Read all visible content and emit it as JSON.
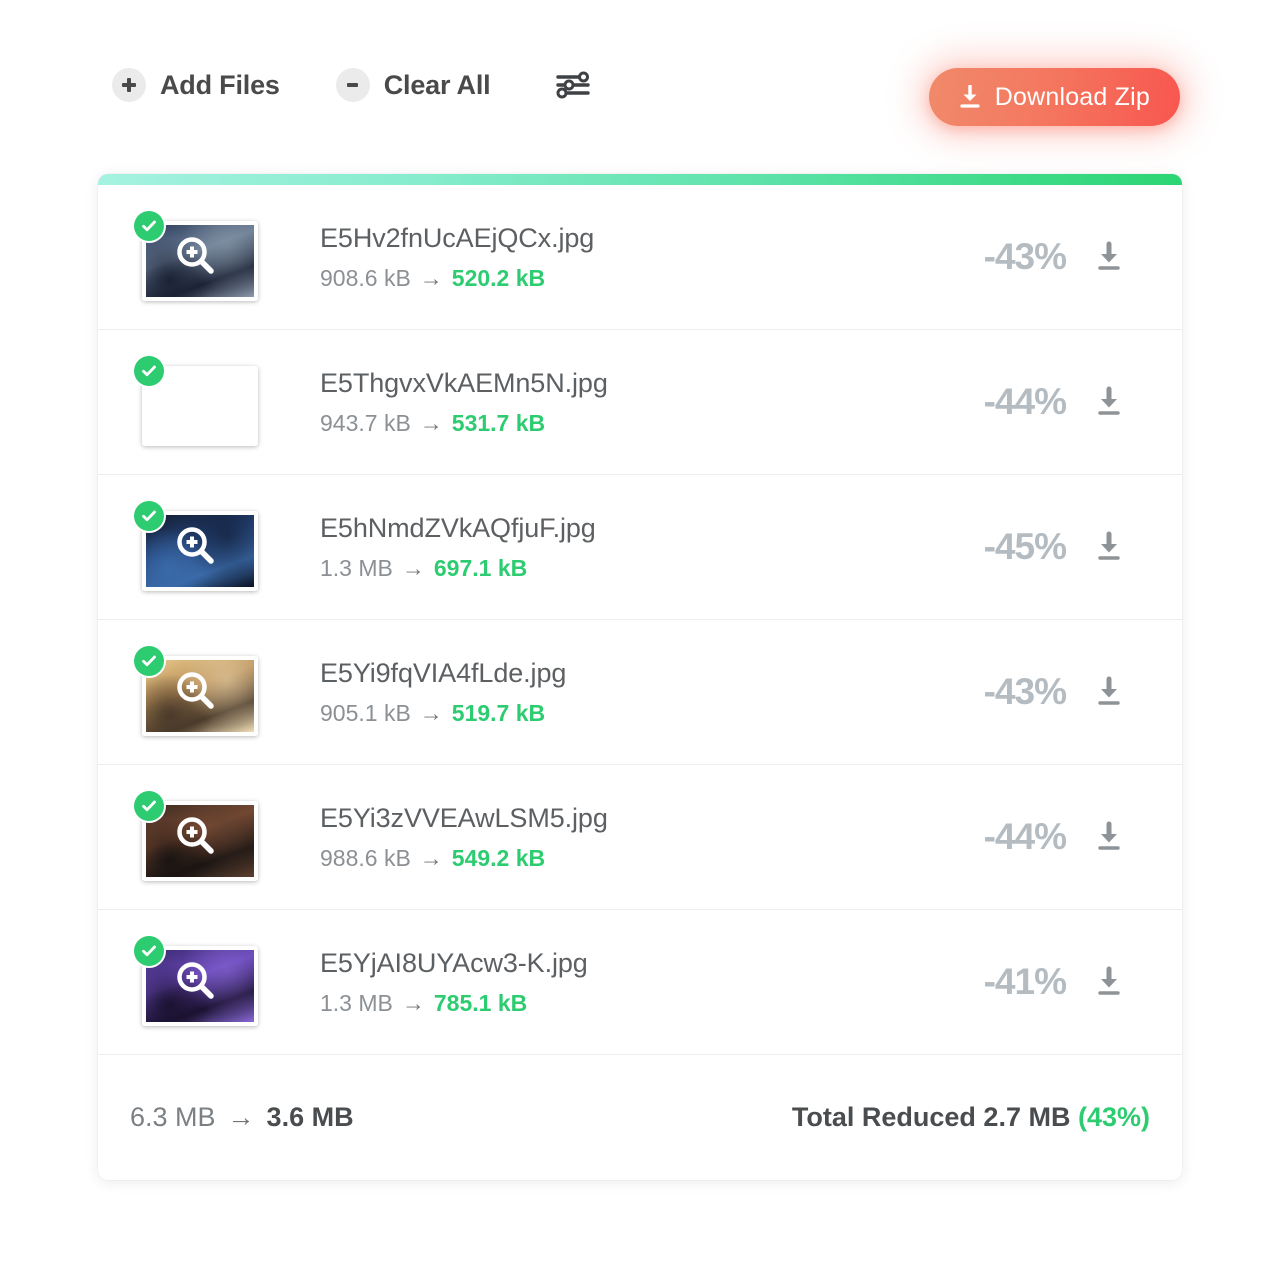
{
  "toolbar": {
    "add_files_label": "Add Files",
    "add_files_icon": "plus-icon",
    "clear_all_label": "Clear All",
    "clear_all_icon": "minus-icon",
    "settings_icon": "sliders-icon",
    "download_zip_label": "Download Zip",
    "download_zip_icon": "download-icon",
    "download_zip_gradient_from": "#f08a6a",
    "download_zip_gradient_to": "#f8564f"
  },
  "card": {
    "progress_gradient_from": "#a5f2e0",
    "progress_gradient_to": "#2bd573",
    "status_icon": "check-circle-icon",
    "thumb_overlay_icon": "magnifier-plus-icon",
    "row_download_icon": "download-icon",
    "arrow": "→",
    "accent_green": "#2ecc71",
    "pct_color": "#b4bcc2"
  },
  "files": [
    {
      "name": "E5Hv2fnUcAEjQCx.jpg",
      "size_before": "908.6 kB",
      "size_after": "520.2 kB",
      "reduction": "-43%",
      "thumb_colors": [
        "#2b3d5c",
        "#6d7f96",
        "#1b2235",
        "#8d9bab"
      ]
    },
    {
      "name": "E5ThgvxVkAEMn5N.jpg",
      "size_before": "943.7 kB",
      "size_after": "531.7 kB",
      "reduction": "-44%",
      "thumb_colors": [
        "#8a3a10",
        "#d9641d",
        "#f0a košice",
        "#5a2408"
      ]
    },
    {
      "name": "E5hNmdZVkAQfjuF.jpg",
      "size_before": "1.3 MB",
      "size_after": "697.1 kB",
      "reduction": "-45%",
      "thumb_colors": [
        "#121a2c",
        "#25457a",
        "#3a6aa8",
        "#0b1020"
      ]
    },
    {
      "name": "E5Yi9fqVIA4fLde.jpg",
      "size_before": "905.1 kB",
      "size_after": "519.7 kB",
      "reduction": "-43%",
      "thumb_colors": [
        "#e8c98a",
        "#b98f5a",
        "#4a3a2a",
        "#f2e0b8"
      ]
    },
    {
      "name": "E5Yi3zVVEAwLSM5.jpg",
      "size_before": "988.6 kB",
      "size_after": "549.2 kB",
      "reduction": "-44%",
      "thumb_colors": [
        "#3a2a22",
        "#7a4a32",
        "#1a1412",
        "#5c4030"
      ]
    },
    {
      "name": "E5YjAI8UYAcw3-K.jpg",
      "size_before": "1.3 MB",
      "size_after": "785.1 kB",
      "reduction": "-41%",
      "thumb_colors": [
        "#3a2a6e",
        "#6a48b8",
        "#1a1230",
        "#8a6ad8"
      ]
    }
  ],
  "footer": {
    "total_before": "6.3 MB",
    "arrow": "→",
    "total_after": "3.6 MB",
    "summary_label": "Total Reduced 2.7 MB",
    "summary_pct": "(43%)"
  }
}
